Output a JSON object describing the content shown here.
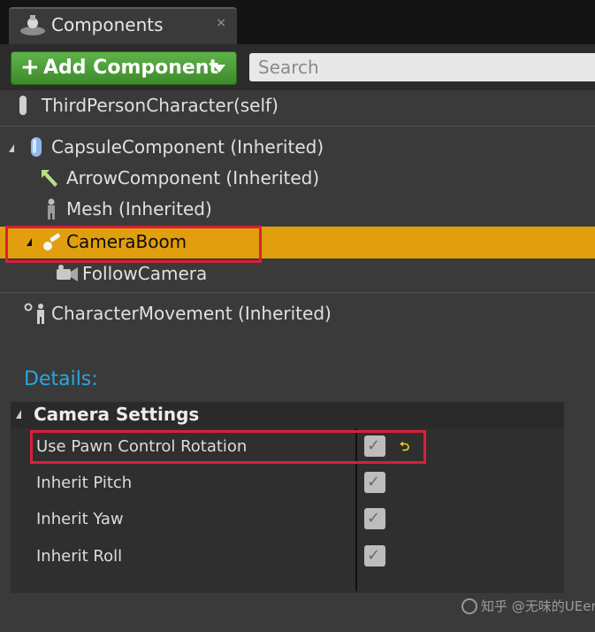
{
  "tab": {
    "title": "Components",
    "close": "×"
  },
  "toolbar": {
    "add_component": "Add Component",
    "search_placeholder": "Search"
  },
  "tree": {
    "self": "ThirdPersonCharacter(self)",
    "capsule": "CapsuleComponent (Inherited)",
    "arrow": "ArrowComponent (Inherited)",
    "mesh": "Mesh (Inherited)",
    "camera_boom": "CameraBoom",
    "follow_camera": "FollowCamera",
    "movement": "CharacterMovement (Inherited)"
  },
  "details": {
    "title": "Details:",
    "section": "Camera Settings",
    "properties": [
      {
        "label": "Use Pawn Control Rotation",
        "checked": true
      },
      {
        "label": "Inherit Pitch",
        "checked": true
      },
      {
        "label": "Inherit Yaw",
        "checked": true
      },
      {
        "label": "Inherit Roll",
        "checked": true
      }
    ]
  },
  "watermark": "知乎 @无味的UEer",
  "colors": {
    "selected_row": "#e19e0d",
    "add_button": "#4ea33a",
    "details_title": "#2aa5e0",
    "highlight_box": "#d8203a"
  }
}
